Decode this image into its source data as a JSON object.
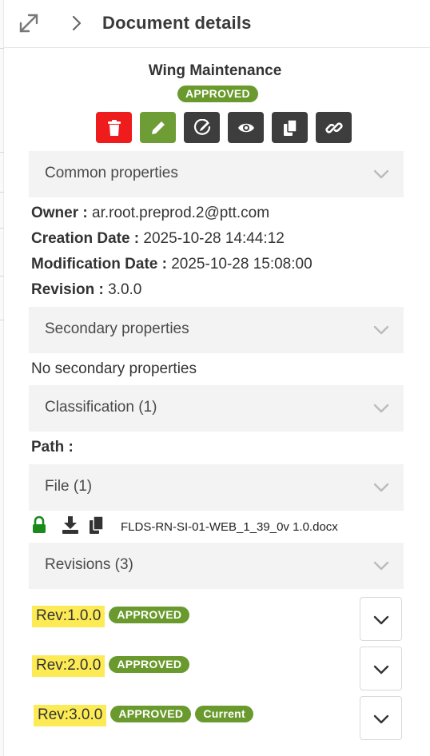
{
  "header": {
    "title": "Document details"
  },
  "document": {
    "name": "Wing Maintenance",
    "status": "APPROVED"
  },
  "actions": [
    {
      "name": "delete",
      "icon": "trash-icon",
      "color": "#ee1c1c"
    },
    {
      "name": "edit",
      "icon": "pencil-icon",
      "color": "#6e9d35"
    },
    {
      "name": "sign",
      "icon": "signature-icon",
      "color": "#3d3d3d"
    },
    {
      "name": "view",
      "icon": "eye-icon",
      "color": "#3d3d3d"
    },
    {
      "name": "copy",
      "icon": "copy-icon",
      "color": "#3d3d3d"
    },
    {
      "name": "link",
      "icon": "link-icon",
      "color": "#3d3d3d"
    }
  ],
  "sections": {
    "common": "Common properties",
    "secondary": "Secondary properties",
    "classification": "Classification (1)",
    "file": "File (1)",
    "revisions": "Revisions (3)"
  },
  "common_properties": {
    "owner_label": "Owner :",
    "owner_value": "ar.root.preprod.2@ptt.com",
    "creation_label": "Creation Date :",
    "creation_value": "2025-10-28 14:44:12",
    "modification_label": "Modification Date :",
    "modification_value": "2025-10-28 15:08:00",
    "revision_label": "Revision :",
    "revision_value": "3.0.0"
  },
  "secondary_properties": {
    "empty_text": "No secondary properties"
  },
  "classification": {
    "path_label": "Path :"
  },
  "file": {
    "name": "FLDS-RN-SI-01-WEB_1_39_0v 1.0.docx"
  },
  "revisions": [
    {
      "label": "Rev:1.0.0",
      "status": "APPROVED"
    },
    {
      "label": "Rev:2.0.0",
      "status": "APPROVED"
    },
    {
      "label": "Rev:3.0.0",
      "status": "APPROVED",
      "current_label": "Current"
    }
  ],
  "colors": {
    "approved": "#6a9a2d",
    "highlight": "#fdeb55",
    "danger": "#ee1c1c",
    "lock": "#1a8a1a"
  }
}
